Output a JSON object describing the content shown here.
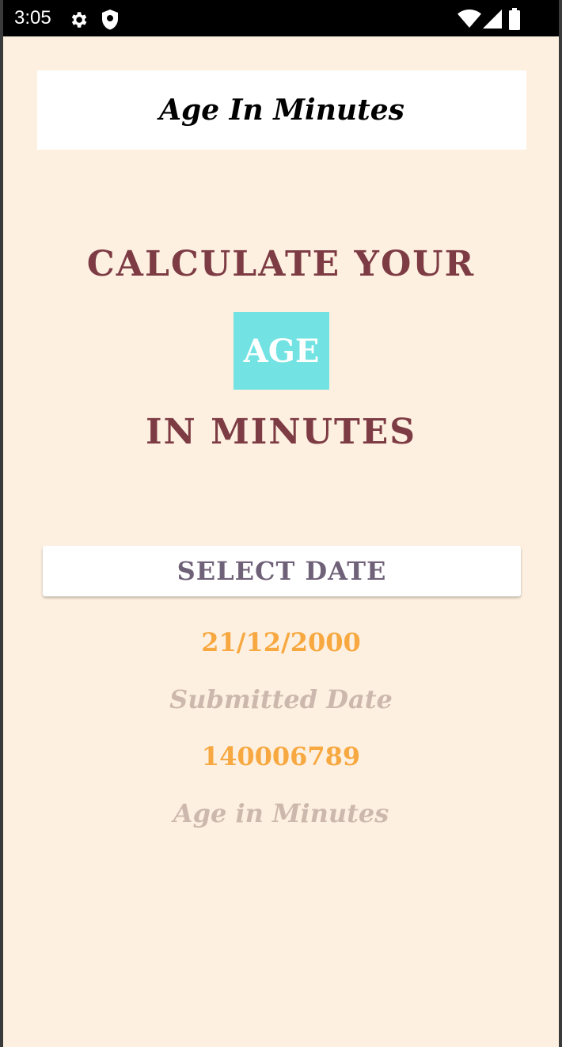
{
  "status_bar": {
    "time": "3:05",
    "left_icons": [
      "gear-icon",
      "shield-icon"
    ],
    "right_icons": [
      "wifi-icon",
      "signal-icon",
      "battery-icon"
    ]
  },
  "app_bar": {
    "title": "Age In Minutes"
  },
  "headline": {
    "line1": "CALCULATE YOUR",
    "highlight": "AGE",
    "line3": "IN MINUTES"
  },
  "actions": {
    "select_date_label": "SELECT DATE"
  },
  "results": {
    "selected_date": "21/12/2000",
    "selected_date_caption": "Submitted Date",
    "age_in_minutes": "140006789",
    "age_in_minutes_caption": "Age in Minutes"
  },
  "colors": {
    "background": "#fdf0e0",
    "headline": "#7d3b44",
    "highlight_box": "#72e2e2",
    "value_text": "#f7a840",
    "caption_text": "#cdb8ae",
    "button_text": "#6f6177"
  }
}
